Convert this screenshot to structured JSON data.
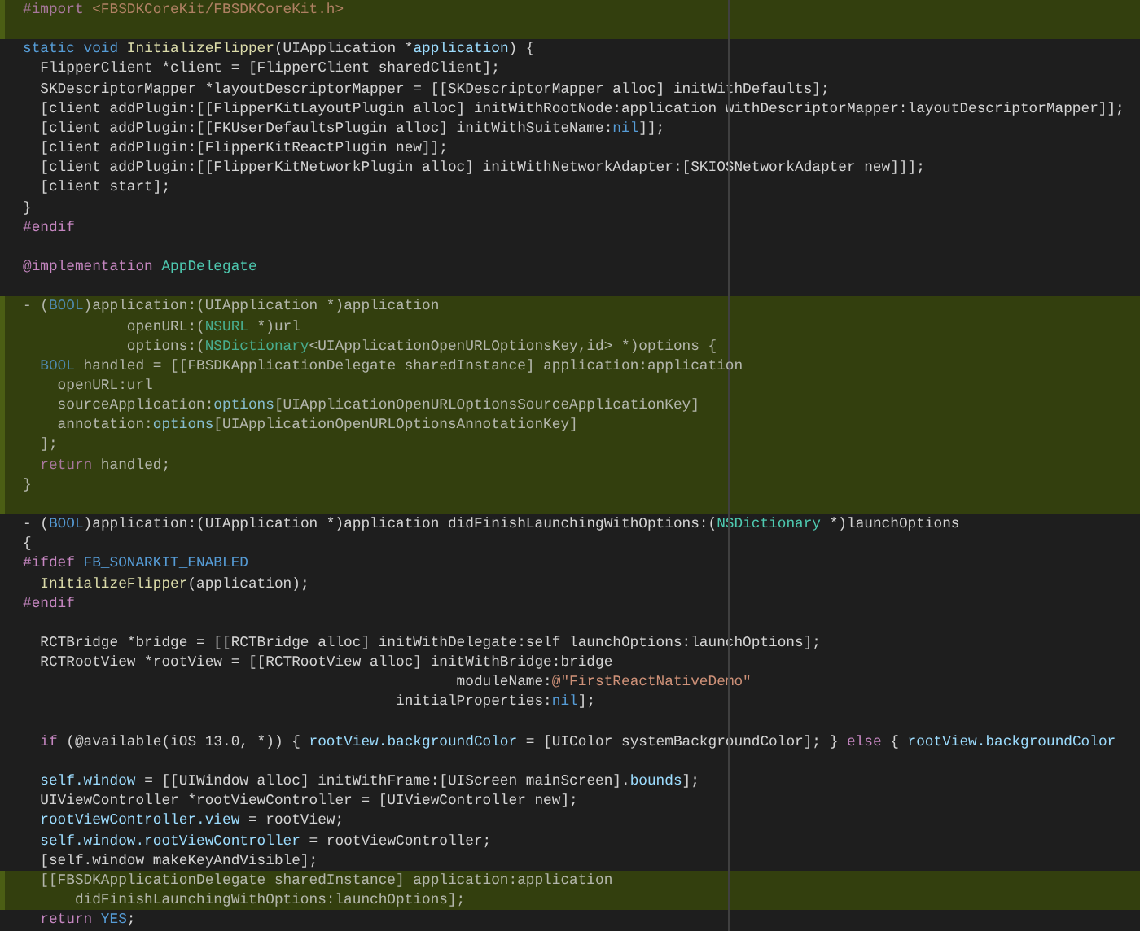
{
  "editor": {
    "lines": [
      {
        "highlighted": true,
        "tokens": [
          {
            "text": "#import",
            "kind": "preproc"
          },
          {
            "text": " <FBSDKCoreKit/FBSDKCoreKit.h>",
            "kind": "string"
          }
        ]
      },
      {
        "highlighted": true
      },
      {
        "highlighted": false,
        "tokens": [
          {
            "text": "static void ",
            "kind": "keyword"
          },
          {
            "text": "InitializeFlipper",
            "kind": "func"
          },
          {
            "text": "(UIApplication *"
          },
          {
            "text": "application",
            "kind": "var"
          },
          {
            "text": ") {"
          }
        ]
      },
      {
        "highlighted": false,
        "tokens": [
          {
            "text": "  FlipperClient *client = [FlipperClient sharedClient];"
          }
        ]
      },
      {
        "highlighted": false,
        "tokens": [
          {
            "text": "  SKDescriptorMapper *layoutDescriptorMapper = [[SKDescriptorMapper alloc] initWithDefaults];"
          }
        ]
      },
      {
        "highlighted": false,
        "tokens": [
          {
            "text": "  [client addPlugin:[[FlipperKitLayoutPlugin alloc] initWithRootNode:application withDescriptorMapper:layoutDescriptorMapper]];"
          }
        ]
      },
      {
        "highlighted": false,
        "tokens": [
          {
            "text": "  [client addPlugin:[[FKUserDefaultsPlugin alloc] initWithSuiteName:"
          },
          {
            "text": "nil",
            "kind": "keyword"
          },
          {
            "text": "]];"
          }
        ]
      },
      {
        "highlighted": false,
        "tokens": [
          {
            "text": "  [client addPlugin:[FlipperKitReactPlugin new]];"
          }
        ]
      },
      {
        "highlighted": false,
        "tokens": [
          {
            "text": "  [client addPlugin:[[FlipperKitNetworkPlugin alloc] initWithNetworkAdapter:[SKIOSNetworkAdapter new]]];"
          }
        ]
      },
      {
        "highlighted": false,
        "tokens": [
          {
            "text": "  [client start];"
          }
        ]
      },
      {
        "highlighted": false,
        "tokens": [
          {
            "text": "}"
          }
        ]
      },
      {
        "highlighted": false,
        "tokens": [
          {
            "text": "#endif",
            "kind": "preproc"
          }
        ]
      },
      {
        "highlighted": false
      },
      {
        "highlighted": false,
        "tokens": [
          {
            "text": "@implementation ",
            "kind": "preproc"
          },
          {
            "text": "AppDelegate",
            "kind": "type"
          }
        ]
      },
      {
        "highlighted": false
      },
      {
        "highlighted": true,
        "tokens": [
          {
            "text": "- ("
          },
          {
            "text": "BOOL",
            "kind": "keyword"
          },
          {
            "text": ")application:(UIApplication *)application"
          }
        ]
      },
      {
        "highlighted": true,
        "tokens": [
          {
            "text": "            openURL:("
          },
          {
            "text": "NSURL",
            "kind": "type"
          },
          {
            "text": " *)url"
          }
        ]
      },
      {
        "highlighted": true,
        "tokens": [
          {
            "text": "            options:("
          },
          {
            "text": "NSDictionary",
            "kind": "type"
          },
          {
            "text": "<UIApplicationOpenURLOptionsKey,id> *)options {"
          }
        ]
      },
      {
        "highlighted": true,
        "tokens": [
          {
            "text": "  BOOL",
            "kind": "keyword"
          },
          {
            "text": " handled = [[FBSDKApplicationDelegate sharedInstance] application:application"
          }
        ]
      },
      {
        "highlighted": true,
        "tokens": [
          {
            "text": "    openURL:url"
          }
        ]
      },
      {
        "highlighted": true,
        "tokens": [
          {
            "text": "    sourceApplication:"
          },
          {
            "text": "options",
            "kind": "var"
          },
          {
            "text": "[UIApplicationOpenURLOptionsSourceApplicationKey]"
          }
        ]
      },
      {
        "highlighted": true,
        "tokens": [
          {
            "text": "    annotation:"
          },
          {
            "text": "options",
            "kind": "var"
          },
          {
            "text": "[UIApplicationOpenURLOptionsAnnotationKey]"
          }
        ]
      },
      {
        "highlighted": true,
        "tokens": [
          {
            "text": "  ];"
          }
        ]
      },
      {
        "highlighted": true,
        "tokens": [
          {
            "text": "  return",
            "kind": "control"
          },
          {
            "text": " handled;"
          }
        ]
      },
      {
        "highlighted": true,
        "tokens": [
          {
            "text": "}"
          }
        ]
      },
      {
        "highlighted": true
      },
      {
        "highlighted": false,
        "tokens": [
          {
            "text": "- ("
          },
          {
            "text": "BOOL",
            "kind": "keyword"
          },
          {
            "text": ")application:(UIApplication *)application didFinishLaunchingWithOptions:("
          },
          {
            "text": "NSDictionary",
            "kind": "type"
          },
          {
            "text": " *)launchOptions"
          }
        ]
      },
      {
        "highlighted": false,
        "tokens": [
          {
            "text": "{"
          }
        ]
      },
      {
        "highlighted": false,
        "tokens": [
          {
            "text": "#ifdef ",
            "kind": "preproc"
          },
          {
            "text": "FB_SONARKIT_ENABLED",
            "kind": "keyword"
          }
        ]
      },
      {
        "highlighted": false,
        "tokens": [
          {
            "text": "  InitializeFlipper",
            "kind": "func"
          },
          {
            "text": "(application);"
          }
        ]
      },
      {
        "highlighted": false,
        "tokens": [
          {
            "text": "#endif",
            "kind": "preproc"
          }
        ]
      },
      {
        "highlighted": false
      },
      {
        "highlighted": false,
        "tokens": [
          {
            "text": "  RCTBridge *bridge = [[RCTBridge alloc] initWithDelegate:self launchOptions:launchOptions];"
          }
        ]
      },
      {
        "highlighted": false,
        "tokens": [
          {
            "text": "  RCTRootView *rootView = [[RCTRootView alloc] initWithBridge:bridge"
          }
        ]
      },
      {
        "highlighted": false,
        "tokens": [
          {
            "text": "                                                  moduleName:"
          },
          {
            "text": "@\"FirstReactNativeDemo\"",
            "kind": "string"
          }
        ]
      },
      {
        "highlighted": false,
        "tokens": [
          {
            "text": "                                           initialProperties:"
          },
          {
            "text": "nil",
            "kind": "keyword"
          },
          {
            "text": "];"
          }
        ]
      },
      {
        "highlighted": false
      },
      {
        "highlighted": false,
        "tokens": [
          {
            "text": "  if",
            "kind": "control"
          },
          {
            "text": " (@available(iOS 13.0, *)) { "
          },
          {
            "text": "rootView.backgroundColor",
            "kind": "var"
          },
          {
            "text": " = [UIColor systemBackgroundColor]; } "
          },
          {
            "text": "else",
            "kind": "control"
          },
          {
            "text": " { "
          },
          {
            "text": "rootView.backgroundColor",
            "kind": "var"
          }
        ]
      },
      {
        "highlighted": false
      },
      {
        "highlighted": false,
        "tokens": [
          {
            "text": "  self.window",
            "kind": "var"
          },
          {
            "text": " = [[UIWindow alloc] initWithFrame:[UIScreen mainScreen]."
          },
          {
            "text": "bounds",
            "kind": "var"
          },
          {
            "text": "];"
          }
        ]
      },
      {
        "highlighted": false,
        "tokens": [
          {
            "text": "  UIViewController *rootViewController = [UIViewController new];"
          }
        ]
      },
      {
        "highlighted": false,
        "tokens": [
          {
            "text": "  rootViewController.view",
            "kind": "var"
          },
          {
            "text": " = rootView;"
          }
        ]
      },
      {
        "highlighted": false,
        "tokens": [
          {
            "text": "  self.window.rootViewController",
            "kind": "var"
          },
          {
            "text": " = rootViewController;"
          }
        ]
      },
      {
        "highlighted": false,
        "tokens": [
          {
            "text": "  [self.window makeKeyAndVisible];"
          }
        ]
      },
      {
        "highlighted": true,
        "tokens": [
          {
            "text": "  [[FBSDKApplicationDelegate sharedInstance] application:application"
          }
        ]
      },
      {
        "highlighted": true,
        "tokens": [
          {
            "text": "      didFinishLaunchingWithOptions:launchOptions];"
          }
        ]
      },
      {
        "highlighted": false,
        "tokens": [
          {
            "text": "  return",
            "kind": "control"
          },
          {
            "text": " YES",
            "kind": "keyword"
          },
          {
            "text": ";"
          }
        ]
      }
    ]
  }
}
